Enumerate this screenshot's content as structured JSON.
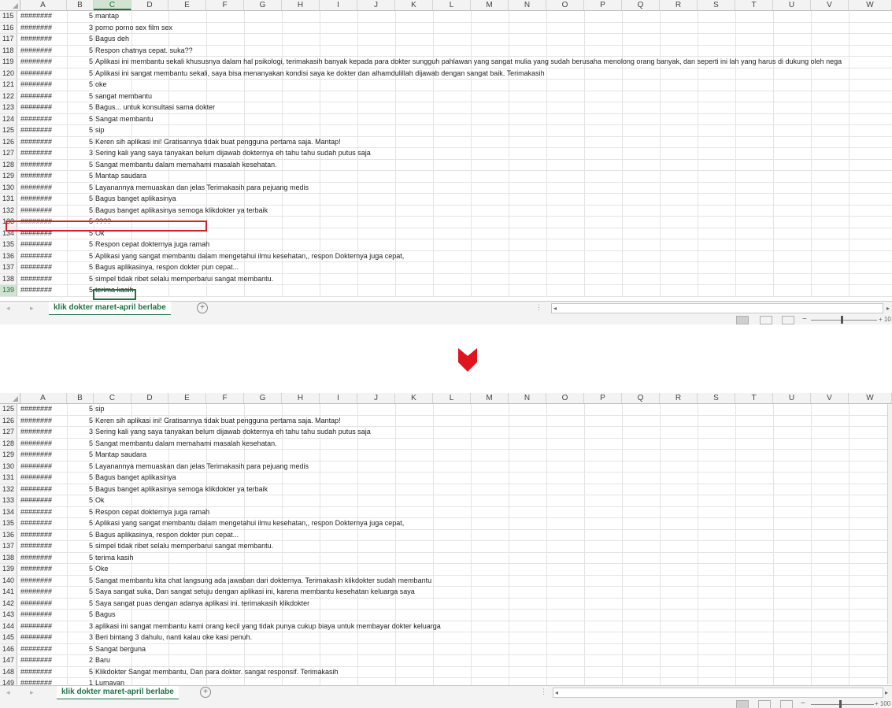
{
  "columns": [
    "A",
    "B",
    "C",
    "D",
    "E",
    "F",
    "G",
    "H",
    "I",
    "J",
    "K",
    "L",
    "M",
    "N",
    "O",
    "P",
    "Q",
    "R",
    "S",
    "T",
    "U",
    "V",
    "W"
  ],
  "date_placeholder": "########",
  "sheet_tab_label": "klik dokter maret-april berlabe",
  "add_sheet_label": "+",
  "zoom_top": "+ 10",
  "zoom_bottom": "+ 100",
  "top_rows": [
    {
      "n": "115",
      "rating": "5",
      "text": "mantap"
    },
    {
      "n": "116",
      "rating": "3",
      "text": "porno porno sex film sex"
    },
    {
      "n": "117",
      "rating": "5",
      "text": "Bagus deh"
    },
    {
      "n": "118",
      "rating": "5",
      "text": "Respon chatnya cepat. suka??"
    },
    {
      "n": "119",
      "rating": "5",
      "text": "Aplikasi ini membantu sekali khususnya dalam hal psikologi, terimakasih banyak kepada para dokter sungguh pahlawan yang sangat mulia yang sudah berusaha menolong orang banyak, dan seperti ini lah yang harus di dukung oleh nega"
    },
    {
      "n": "120",
      "rating": "5",
      "text": "Aplikasi ini sangat membantu sekali, saya bisa menanyakan kondisi saya ke dokter dan alhamdulillah dijawab dengan sangat baik. Terimakasih"
    },
    {
      "n": "121",
      "rating": "5",
      "text": "oke"
    },
    {
      "n": "122",
      "rating": "5",
      "text": "sangat membantu"
    },
    {
      "n": "123",
      "rating": "5",
      "text": "Bagus... untuk konsultasi sama dokter"
    },
    {
      "n": "124",
      "rating": "5",
      "text": "Sangat membantu"
    },
    {
      "n": "125",
      "rating": "5",
      "text": "sip"
    },
    {
      "n": "126",
      "rating": "5",
      "text": "Keren sih aplikasi ini! Gratisannya tidak buat pengguna pertama saja. Mantap!"
    },
    {
      "n": "127",
      "rating": "3",
      "text": "Sering kali yang saya tanyakan belum dijawab dokternya eh tahu tahu sudah putus saja"
    },
    {
      "n": "128",
      "rating": "5",
      "text": "Sangat membantu dalam memahami masalah kesehatan."
    },
    {
      "n": "129",
      "rating": "5",
      "text": "Mantap saudara"
    },
    {
      "n": "130",
      "rating": "5",
      "text": "Layanannya memuaskan dan jelas Terimakasih para pejuang medis"
    },
    {
      "n": "131",
      "rating": "5",
      "text": "Bagus banget aplikasinya"
    },
    {
      "n": "132",
      "rating": "5",
      "text": "Bagus banget aplikasinya semoga klikdokter ya terbaik"
    },
    {
      "n": "133",
      "rating": "5",
      "text": "????"
    },
    {
      "n": "134",
      "rating": "5",
      "text": "Ok"
    },
    {
      "n": "135",
      "rating": "5",
      "text": "Respon cepat dokternya juga ramah"
    },
    {
      "n": "136",
      "rating": "5",
      "text": "Aplikasi yang sangat membantu dalam mengetahui ilmu kesehatan,, respon Dokternya juga cepat,"
    },
    {
      "n": "137",
      "rating": "5",
      "text": "Bagus aplikasinya, respon dokter pun cepat..."
    },
    {
      "n": "138",
      "rating": "5",
      "text": "simpel tidak ribet selalu memperbarui sangat membantu."
    },
    {
      "n": "139",
      "rating": "5",
      "text": "terima kasih"
    }
  ],
  "bottom_rows": [
    {
      "n": "125",
      "rating": "5",
      "text": "sip"
    },
    {
      "n": "126",
      "rating": "5",
      "text": "Keren sih aplikasi ini! Gratisannya tidak buat pengguna pertama saja. Mantap!"
    },
    {
      "n": "127",
      "rating": "3",
      "text": "Sering kali yang saya tanyakan belum dijawab dokternya eh tahu tahu sudah putus saja"
    },
    {
      "n": "128",
      "rating": "5",
      "text": "Sangat membantu dalam memahami masalah kesehatan."
    },
    {
      "n": "129",
      "rating": "5",
      "text": "Mantap saudara"
    },
    {
      "n": "130",
      "rating": "5",
      "text": "Layanannya memuaskan dan jelas Terimakasih para pejuang medis"
    },
    {
      "n": "131",
      "rating": "5",
      "text": "Bagus banget aplikasinya"
    },
    {
      "n": "132",
      "rating": "5",
      "text": "Bagus banget aplikasinya semoga klikdokter ya terbaik"
    },
    {
      "n": "133",
      "rating": "5",
      "text": "Ok"
    },
    {
      "n": "134",
      "rating": "5",
      "text": "Respon cepat dokternya juga ramah"
    },
    {
      "n": "135",
      "rating": "5",
      "text": "Aplikasi yang sangat membantu dalam mengetahui ilmu kesehatan,, respon Dokternya juga cepat,"
    },
    {
      "n": "136",
      "rating": "5",
      "text": "Bagus aplikasinya, respon dokter pun cepat..."
    },
    {
      "n": "137",
      "rating": "5",
      "text": "simpel tidak ribet selalu memperbarui sangat membantu."
    },
    {
      "n": "138",
      "rating": "5",
      "text": "terima kasih"
    },
    {
      "n": "139",
      "rating": "5",
      "text": "Oke"
    },
    {
      "n": "140",
      "rating": "5",
      "text": "Sangat membantu kita chat langsung ada jawaban dari dokternya. Terimakasih klikdokter sudah membantu"
    },
    {
      "n": "141",
      "rating": "5",
      "text": "Saya sangat suka, Dan sangat setuju dengan aplikasi ini, karena membantu kesehatan keluarga saya"
    },
    {
      "n": "142",
      "rating": "5",
      "text": "Saya sangat puas dengan adanya aplikasi ini. terimakasih klikdokter"
    },
    {
      "n": "143",
      "rating": "5",
      "text": "Bagus"
    },
    {
      "n": "144",
      "rating": "3",
      "text": "aplikasi ini sangat membantu kami orang kecil yang tidak punya cukup biaya untuk membayar dokter keluarga"
    },
    {
      "n": "145",
      "rating": "3",
      "text": "Beri bintang 3 dahulu, nanti kalau oke kasi penuh."
    },
    {
      "n": "146",
      "rating": "5",
      "text": "Sangat berguna"
    },
    {
      "n": "147",
      "rating": "2",
      "text": "Baru"
    },
    {
      "n": "148",
      "rating": "5",
      "text": "Klikdokter Sangat membantu, Dan para dokter. sangat responsif. Terimakasih"
    },
    {
      "n": "149",
      "rating": "1",
      "text": "Lumayan"
    }
  ],
  "colors": {
    "excel_green": "#217346",
    "highlight_red": "#d3202a",
    "arrow_red": "#e0141e"
  },
  "icons": {
    "arrow": "down-arrow-icon"
  }
}
